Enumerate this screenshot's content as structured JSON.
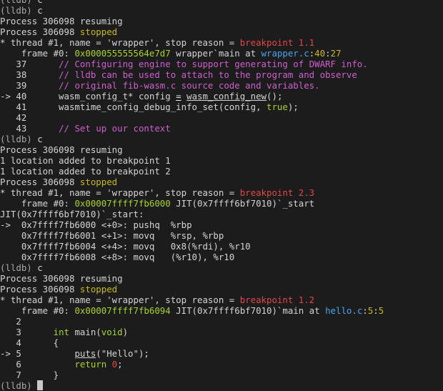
{
  "window": {
    "background": "#1c1c1c"
  },
  "palette": {
    "default": "#d4d4d4",
    "prompt": "#a8a8a8",
    "red": "#e04848",
    "green": "#a6d32e",
    "yellow": "#c9b821",
    "magenta": "#d05ed0",
    "blue": "#4aa3ee",
    "white": "#ececec"
  },
  "terminal": {
    "lines": [
      [
        {
          "t": "(lldb) ",
          "c": "prompt"
        },
        {
          "t": "c",
          "c": "default"
        }
      ],
      [
        {
          "t": "(lldb) ",
          "c": "prompt"
        },
        {
          "t": "c",
          "c": "default"
        }
      ],
      [
        {
          "t": "Process 306098 resuming",
          "c": "default"
        }
      ],
      [
        {
          "t": "Process 306098 ",
          "c": "default"
        },
        {
          "t": "stopped",
          "c": "yellow"
        }
      ],
      [
        {
          "t": "* thread #1, name = 'wrapper', stop reason = ",
          "c": "default"
        },
        {
          "t": "breakpoint 1.1",
          "c": "red"
        }
      ],
      [
        {
          "t": "    frame #0: ",
          "c": "default"
        },
        {
          "t": "0x000055555564e7d7",
          "c": "green"
        },
        {
          "t": " wrapper`main at ",
          "c": "default"
        },
        {
          "t": "wrapper.c",
          "c": "blue"
        },
        {
          "t": ":",
          "c": "default"
        },
        {
          "t": "40",
          "c": "yellow"
        },
        {
          "t": ":",
          "c": "default"
        },
        {
          "t": "27",
          "c": "yellow"
        }
      ],
      [
        {
          "t": "   37      ",
          "c": "default"
        },
        {
          "t": "// Configuring engine to support generating of DWARF info.",
          "c": "magenta"
        }
      ],
      [
        {
          "t": "   38      ",
          "c": "default"
        },
        {
          "t": "// lldb can be used to attach to the program and observe",
          "c": "magenta"
        }
      ],
      [
        {
          "t": "   39      ",
          "c": "default"
        },
        {
          "t": "// original fib-wasm.c source code and variables.",
          "c": "magenta"
        }
      ],
      [
        {
          "t": "-> 40      wasm_config_t* config ",
          "c": "default"
        },
        {
          "t": "=",
          "c": "white",
          "u": true
        },
        {
          "t": " ",
          "c": "default"
        },
        {
          "t": "wasm_config_new",
          "c": "default",
          "u": true
        },
        {
          "t": "();",
          "c": "default"
        }
      ],
      [
        {
          "t": "   41      wasmtime_config_debug_info_set(config, ",
          "c": "default"
        },
        {
          "t": "true",
          "c": "green"
        },
        {
          "t": ");",
          "c": "default"
        }
      ],
      [
        {
          "t": "   42",
          "c": "default"
        }
      ],
      [
        {
          "t": "   43      ",
          "c": "default"
        },
        {
          "t": "// Set up our context",
          "c": "magenta"
        }
      ],
      [
        {
          "t": "(lldb) ",
          "c": "prompt"
        },
        {
          "t": "c",
          "c": "default"
        }
      ],
      [
        {
          "t": "Process 306098 resuming",
          "c": "default"
        }
      ],
      [
        {
          "t": "1 location added to breakpoint 1",
          "c": "default"
        }
      ],
      [
        {
          "t": "1 location added to breakpoint 2",
          "c": "default"
        }
      ],
      [
        {
          "t": "Process 306098 ",
          "c": "default"
        },
        {
          "t": "stopped",
          "c": "yellow"
        }
      ],
      [
        {
          "t": "* thread #1, name = 'wrapper', stop reason = ",
          "c": "default"
        },
        {
          "t": "breakpoint 2.3",
          "c": "red"
        }
      ],
      [
        {
          "t": "    frame #0: ",
          "c": "default"
        },
        {
          "t": "0x00007ffff7fb6000",
          "c": "green"
        },
        {
          "t": " JIT(0x7ffff6bf7010)`_start",
          "c": "default"
        }
      ],
      [
        {
          "t": "JIT(0x7ffff6bf7010)`_start:",
          "c": "default"
        }
      ],
      [
        {
          "t": "->  0x7ffff7fb6000 <+0>: pushq  %rbp",
          "c": "default"
        }
      ],
      [
        {
          "t": "    0x7ffff7fb6001 <+1>: movq   %rsp, %rbp",
          "c": "default"
        }
      ],
      [
        {
          "t": "    0x7ffff7fb6004 <+4>: movq   0x8(%rdi), %r10",
          "c": "default"
        }
      ],
      [
        {
          "t": "    0x7ffff7fb6008 <+8>: movq   (%r10), %r10",
          "c": "default"
        }
      ],
      [
        {
          "t": "(lldb) ",
          "c": "prompt"
        },
        {
          "t": "c",
          "c": "default"
        }
      ],
      [
        {
          "t": "Process 306098 resuming",
          "c": "default"
        }
      ],
      [
        {
          "t": "Process 306098 ",
          "c": "default"
        },
        {
          "t": "stopped",
          "c": "yellow"
        }
      ],
      [
        {
          "t": "* thread #1, name = 'wrapper', stop reason = ",
          "c": "default"
        },
        {
          "t": "breakpoint 1.2",
          "c": "red"
        }
      ],
      [
        {
          "t": "    frame #0: ",
          "c": "default"
        },
        {
          "t": "0x00007ffff7fb6094",
          "c": "green"
        },
        {
          "t": " JIT(0x7ffff6bf7010)`main at ",
          "c": "default"
        },
        {
          "t": "hello.c",
          "c": "blue"
        },
        {
          "t": ":",
          "c": "default"
        },
        {
          "t": "5",
          "c": "yellow"
        },
        {
          "t": ":",
          "c": "default"
        },
        {
          "t": "5",
          "c": "yellow"
        }
      ],
      [
        {
          "t": "   2",
          "c": "default"
        }
      ],
      [
        {
          "t": "   3      ",
          "c": "default"
        },
        {
          "t": "int",
          "c": "green"
        },
        {
          "t": " main(",
          "c": "default"
        },
        {
          "t": "void",
          "c": "green"
        },
        {
          "t": ")",
          "c": "default"
        }
      ],
      [
        {
          "t": "   4      {",
          "c": "default"
        }
      ],
      [
        {
          "t": "-> 5          ",
          "c": "default"
        },
        {
          "t": "puts",
          "c": "default",
          "u": true
        },
        {
          "t": "(\"Hello\");",
          "c": "default"
        }
      ],
      [
        {
          "t": "   6          ",
          "c": "default"
        },
        {
          "t": "return",
          "c": "green"
        },
        {
          "t": " ",
          "c": "default"
        },
        {
          "t": "0",
          "c": "red"
        },
        {
          "t": ";",
          "c": "default"
        }
      ],
      [
        {
          "t": "   7      }",
          "c": "default"
        }
      ],
      [
        {
          "t": "(lldb) ",
          "c": "prompt"
        }
      ]
    ]
  }
}
